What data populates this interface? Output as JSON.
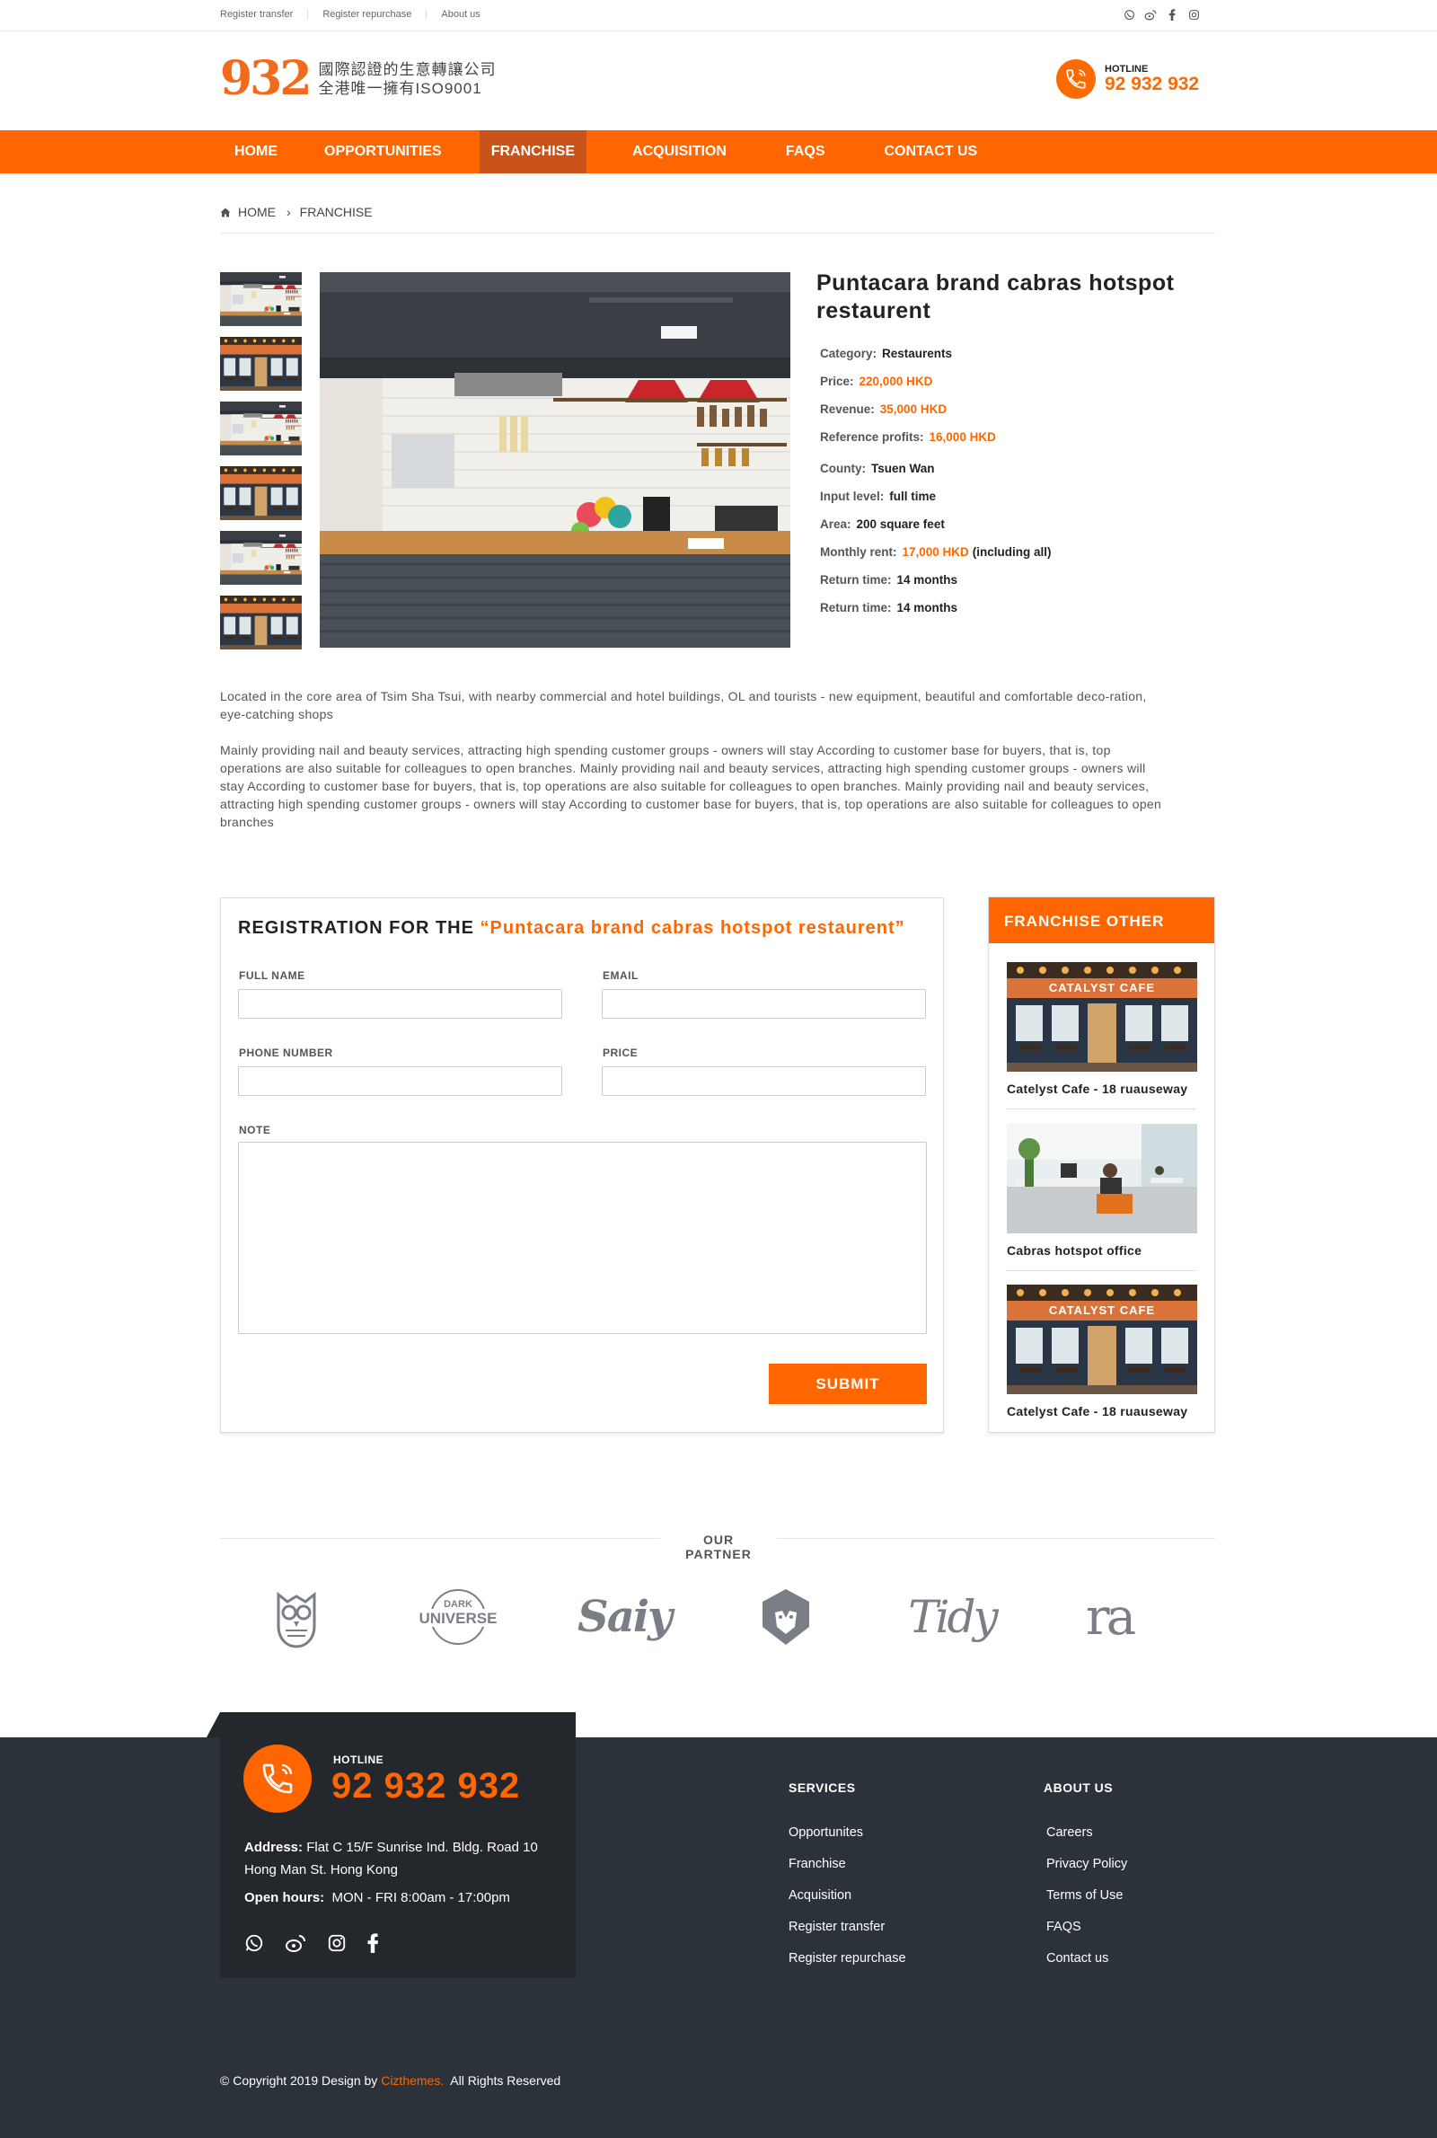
{
  "topbar": {
    "links": [
      "Register transfer",
      "Register repurchase",
      "About us"
    ]
  },
  "logo": {
    "number": "932",
    "line1": "國際認證的生意轉讓公司",
    "line2": "全港唯一擁有ISO9001"
  },
  "hotline": {
    "label": "HOTLINE",
    "number": "92 932 932"
  },
  "nav": {
    "items": [
      "HOME",
      "OPPORTUNITIES",
      "FRANCHISE",
      "ACQUISITION",
      "FAQS",
      "CONTACT US"
    ],
    "active": "FRANCHISE"
  },
  "breadcrumb": {
    "home": "HOME",
    "current": "FRANCHISE"
  },
  "listing": {
    "title": "Puntacara brand cabras hotspot restaurent",
    "rows": [
      {
        "label": "Category:",
        "value": "Restaurents",
        "suffix": ""
      },
      {
        "label": "Price:",
        "value": "220,000 HKD",
        "suffix": ""
      },
      {
        "label": "Revenue:",
        "value": "35,000 HKD",
        "suffix": ""
      },
      {
        "label": "Reference profits:",
        "value": "16,000 HKD",
        "suffix": ""
      },
      {
        "label": "County:",
        "value": "Tsuen Wan",
        "suffix": ""
      },
      {
        "label": "Input level:",
        "value": "full time",
        "suffix": ""
      },
      {
        "label": "Area:",
        "value": "200 square feet",
        "suffix": ""
      },
      {
        "label": "Monthly rent:",
        "value": "17,000 HKD",
        "suffix": "(including all)"
      },
      {
        "label": "Return time:",
        "value": "14 months",
        "suffix": ""
      },
      {
        "label": "Return time:",
        "value": "14 months",
        "suffix": ""
      }
    ],
    "highlight_color": "#ff6600"
  },
  "description": {
    "p1": "Located in the core area of Tsim Sha Tsui, with nearby commercial and hotel buildings, OL and tourists - new equipment, beautiful and comfortable deco-ration, eye-catching shops",
    "p2": "Mainly providing nail and beauty services, attracting high spending customer groups - owners will stay According to customer base for buyers, that is, top operations are also suitable for colleagues to open branches. Mainly providing nail and beauty services, attracting high spending customer groups - owners will stay According to customer base for buyers, that is, top operations are also suitable for colleagues to open branches. Mainly providing nail and beauty services, attracting high spending customer groups - owners will stay According to customer base for buyers, that is, top operations are also suitable for colleagues to open branches"
  },
  "registration": {
    "title_prefix": "REGISTRATION FOR THE",
    "title_name": "“Puntacara brand cabras hotspot restaurent”",
    "full_name_label": "FULL NAME",
    "email_label": "EMAIL",
    "phone_label": "PHONE NUMBER",
    "price_label": "PRICE",
    "note_label": "NOTE",
    "full_name_value": "",
    "email_value": "",
    "phone_value": "",
    "price_value": "",
    "note_value": "",
    "submit_label": "SUBMIT"
  },
  "franchise_other": {
    "title": "FRANCHISE OTHER",
    "items": [
      {
        "title": "Catelyst Cafe - 18 ruauseway",
        "sign": "CATALYST CAFE"
      },
      {
        "title": "Cabras hotspot office"
      },
      {
        "title": "Catelyst Cafe - 18 ruauseway",
        "sign": "CATALYST CAFE"
      }
    ]
  },
  "partner": {
    "title": "OUR PARTNER",
    "logos": [
      "owl-logo",
      "dark-universe-logo",
      "saiy-logo",
      "lion-logo",
      "tidy-logo",
      "ra-logo"
    ],
    "dark_universe_top": "DARK",
    "dark_universe_bottom": "UNIVERSE",
    "saiy": "Saiy",
    "tidy": "Tidy",
    "ra": "ra"
  },
  "footer": {
    "hotline_label": "HOTLINE",
    "hotline_number": "92 932 932",
    "address_label": "Address:",
    "address": "Flat C 15/F Sunrise Ind. Bldg.  Road 10 Hong Man St. Hong Kong",
    "hours_label": "Open hours:",
    "hours": "MON - FRI  8:00am - 17:00pm",
    "services_title": "SERVICES",
    "services": [
      "Opportunites",
      "Franchise",
      "Acquisition",
      "Register transfer",
      "Register repurchase"
    ],
    "about_title": "ABOUT US",
    "about": [
      "Careers",
      "Privacy Policy",
      "Terms of Use",
      "FAQS",
      "Contact us"
    ],
    "copyright_prefix": "© Copyright 2019 Design by",
    "copyright_brand": "Cizthemes.",
    "copyright_suffix": "All Rights Reserved"
  }
}
